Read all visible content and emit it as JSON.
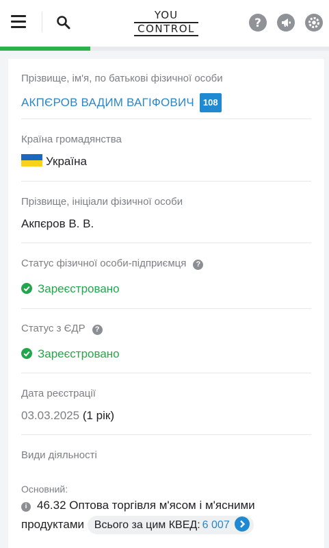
{
  "header": {
    "logo_line1": "YOU",
    "logo_line2": "CONTROL",
    "icons": [
      "menu-icon",
      "search-icon",
      "help-icon",
      "megaphone-icon",
      "gear-icon"
    ]
  },
  "progress": {
    "value": 0.275,
    "color": "#2db14a"
  },
  "fields": {
    "full_name": {
      "label": "Прізвище, ім'я, по батькові фізичної особи",
      "value": "АКПЄРОВ ВАДИМ ВАГІФОВИЧ",
      "badge": "108"
    },
    "country": {
      "label": "Країна громадянства",
      "value": "Україна"
    },
    "initials": {
      "label": "Прізвище, ініціали фізичної особи",
      "value": "Акпєров В. В."
    },
    "fop_status": {
      "label": "Статус фізичної особи-підприємця",
      "help": "?",
      "value": "Зареєстровано"
    },
    "edr_status": {
      "label": "Статус з ЄДР",
      "help": "?",
      "value": "Зареєстровано"
    },
    "reg_date": {
      "label": "Дата реєстрації",
      "date": "03.03.2025",
      "age": "(1 рік)"
    },
    "activities": {
      "label": "Види діяльності",
      "main_label": "Основний:",
      "info": "i",
      "code": "46.32",
      "line1": "Оптова торгівля м'ясом і м'ясними",
      "line2": "продуктами",
      "pill_text": "Всього за цим КВЕД:",
      "pill_count": "6 007"
    }
  },
  "colors": {
    "link": "#2a86c8",
    "badge": "#1f8ad1",
    "status_green": "#22a64b"
  }
}
